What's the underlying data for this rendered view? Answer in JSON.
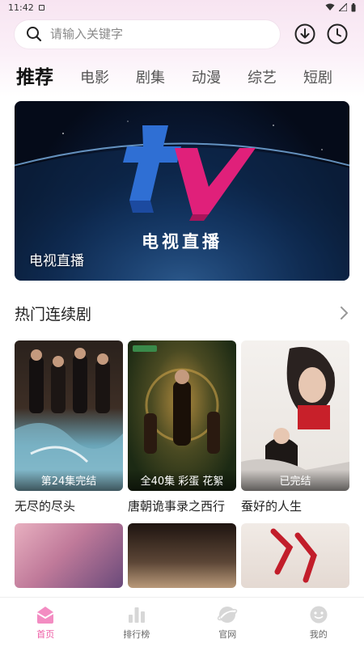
{
  "status_bar": {
    "time": "11:42"
  },
  "search": {
    "placeholder": "请输入关键字"
  },
  "tabs": [
    {
      "label": "推荐",
      "active": true
    },
    {
      "label": "电影",
      "active": false
    },
    {
      "label": "剧集",
      "active": false
    },
    {
      "label": "动漫",
      "active": false
    },
    {
      "label": "综艺",
      "active": false
    },
    {
      "label": "短剧",
      "active": false
    }
  ],
  "banner": {
    "logo_text": "tv",
    "subtitle": "电视直播",
    "caption": "电视直播"
  },
  "section": {
    "title": "热门连续剧"
  },
  "dramas": [
    {
      "title": "无尽的尽头",
      "badge": "第24集完结",
      "colors": [
        "#3a2a22",
        "#7fb7c9"
      ]
    },
    {
      "title": "唐朝诡事录之西行",
      "badge": "全40集 彩蛋 花絮",
      "colors": [
        "#2b3a1c",
        "#b08a3e"
      ]
    },
    {
      "title": "蚕好的人生",
      "badge": "已完结",
      "colors": [
        "#f2f0ee",
        "#c8202a"
      ]
    },
    {
      "title": "",
      "badge": "",
      "colors": [
        "#d8a0b0",
        "#6a4a7a"
      ]
    },
    {
      "title": "",
      "badge": "",
      "colors": [
        "#2a1a14",
        "#b99a7a"
      ]
    },
    {
      "title": "",
      "badge": "",
      "colors": [
        "#efe7e2",
        "#c21d2a"
      ]
    }
  ],
  "bottom_nav": [
    {
      "label": "首页",
      "icon": "home-icon",
      "active": true
    },
    {
      "label": "排行榜",
      "icon": "chart-icon",
      "active": false
    },
    {
      "label": "官网",
      "icon": "globe-icon",
      "active": false
    },
    {
      "label": "我的",
      "icon": "smiley-icon",
      "active": false
    }
  ],
  "colors": {
    "accent": "#ee5aa4",
    "tv_blue": "#2f6fd4",
    "tv_pink": "#e0207a"
  }
}
